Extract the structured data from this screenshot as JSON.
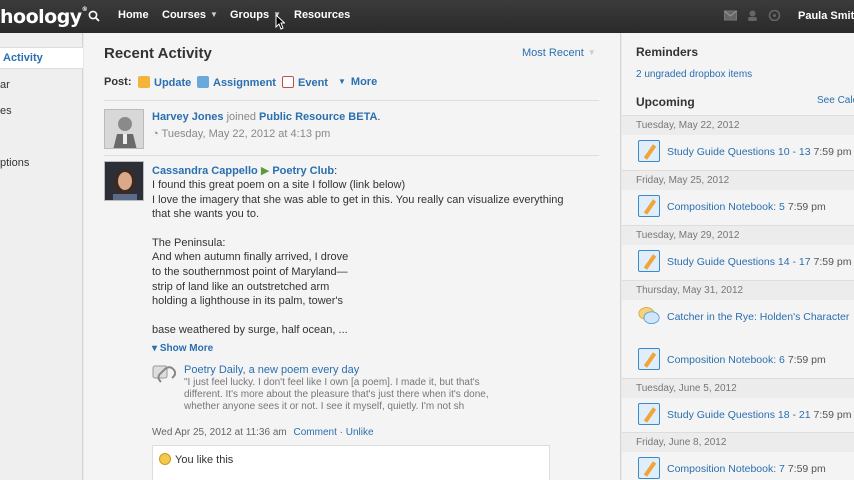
{
  "header": {
    "logo": "hoology",
    "nav": [
      {
        "label": "Home"
      },
      {
        "label": "Courses",
        "has_caret": true
      },
      {
        "label": "Groups",
        "has_caret": true
      },
      {
        "label": "Resources"
      }
    ],
    "user_name": "Paula Smith"
  },
  "sidebar": {
    "items": [
      {
        "label": "Activity",
        "active": true
      },
      {
        "label": "ar"
      },
      {
        "label": "es"
      },
      {
        "label": "ptions"
      }
    ]
  },
  "main": {
    "title": "Recent Activity",
    "sort_label": "Most Recent",
    "post_label": "Post:",
    "post_options": [
      {
        "label": "Update",
        "icon": "update-icon"
      },
      {
        "label": "Assignment",
        "icon": "assignment-icon"
      },
      {
        "label": "Event",
        "icon": "calendar-icon"
      },
      {
        "label": "More",
        "icon": "caret-down-icon"
      }
    ],
    "feed": [
      {
        "author": "Harvey Jones",
        "action": "joined",
        "target": "Public Resource BETA",
        "timestamp": "Tuesday, May 22, 2012 at 4:13 pm"
      },
      {
        "author": "Cassandra Cappello",
        "target": "Poetry Club",
        "lines": [
          "I found this great poem on a site I follow (link below)",
          "I love the imagery that she was able to get in this. You really can visualize everything",
          "that she wants you to.",
          "",
          "The Peninsula:",
          "And when autumn finally arrived, I drove",
          "to the southernmost point of Maryland—",
          "strip of land like an outstretched arm",
          "holding a lighthouse in its palm, tower's",
          "",
          "base weathered by surge, half ocean, ..."
        ],
        "show_more": "Show More",
        "link_title": "Poetry Daily, a new poem every day",
        "link_quote": [
          "\"I just feel lucky. I don't feel like I own [a poem]. I made it, but that's",
          "different. It's more about the pleasure that's just there when it's done,",
          "whether anyone sees it or not. I see it myself, quietly. I'm not sh"
        ],
        "timestamp": "Wed Apr 25, 2012 at 11:36 am",
        "comment_label": "Comment",
        "unlike_label": "Unlike",
        "like_text": "You like this"
      }
    ]
  },
  "right": {
    "reminders_title": "Reminders",
    "reminders_link": "2 ungraded dropbox items",
    "upcoming_title": "Upcoming",
    "see_calendar": "See Cale",
    "days": [
      {
        "date": "Tuesday, May 22, 2012",
        "items": [
          {
            "title": "Study Guide Questions 10 - 13",
            "time": "7:59 pm",
            "icon": "assignment-icon"
          }
        ]
      },
      {
        "date": "Friday, May 25, 2012",
        "items": [
          {
            "title": "Composition Notebook: 5",
            "time": "7:59 pm",
            "icon": "assignment-icon"
          }
        ]
      },
      {
        "date": "Tuesday, May 29, 2012",
        "items": [
          {
            "title": "Study Guide Questions 14 - 17",
            "time": "7:59 pm",
            "icon": "assignment-icon"
          }
        ]
      },
      {
        "date": "Thursday, May 31, 2012",
        "items": [
          {
            "title": "Catcher in the Rye: Holden's Character",
            "time": "",
            "icon": "discussion-icon"
          },
          {
            "title": "Composition Notebook: 6",
            "time": "7:59 pm",
            "icon": "assignment-icon"
          }
        ]
      },
      {
        "date": "Tuesday, June 5, 2012",
        "items": [
          {
            "title": "Study Guide Questions 18 - 21",
            "time": "7:59 pm",
            "icon": "assignment-icon"
          }
        ]
      },
      {
        "date": "Friday, June 8, 2012",
        "items": [
          {
            "title": "Composition Notebook: 7",
            "time": "7:59 pm",
            "icon": "assignment-icon"
          }
        ]
      }
    ]
  }
}
